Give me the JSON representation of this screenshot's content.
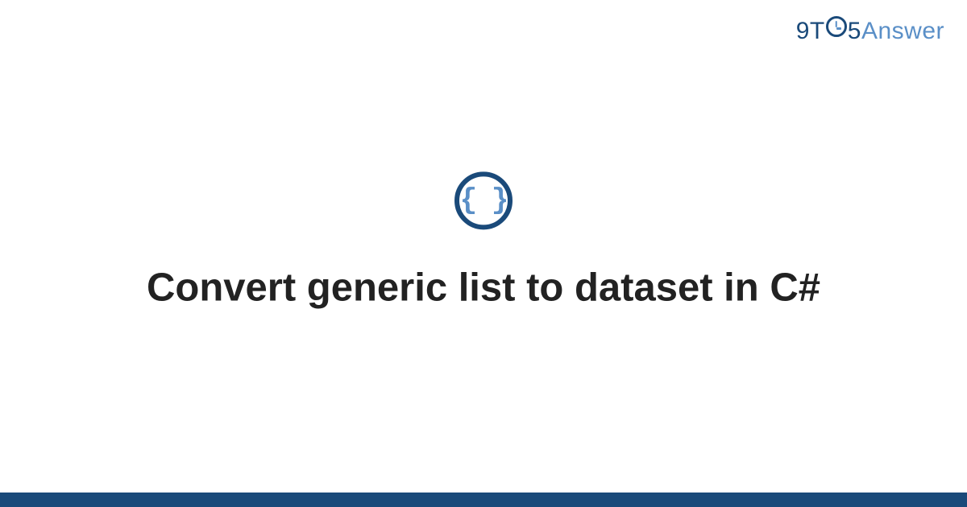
{
  "logo": {
    "part1": "9T",
    "part2": "5",
    "part3": "Answer"
  },
  "icon": {
    "braces": "{ }",
    "name": "code-braces"
  },
  "title": "Convert generic list to dataset in C#",
  "colors": {
    "primary_dark": "#1a4a7a",
    "primary_light": "#5a8fc7",
    "text": "#222222"
  }
}
